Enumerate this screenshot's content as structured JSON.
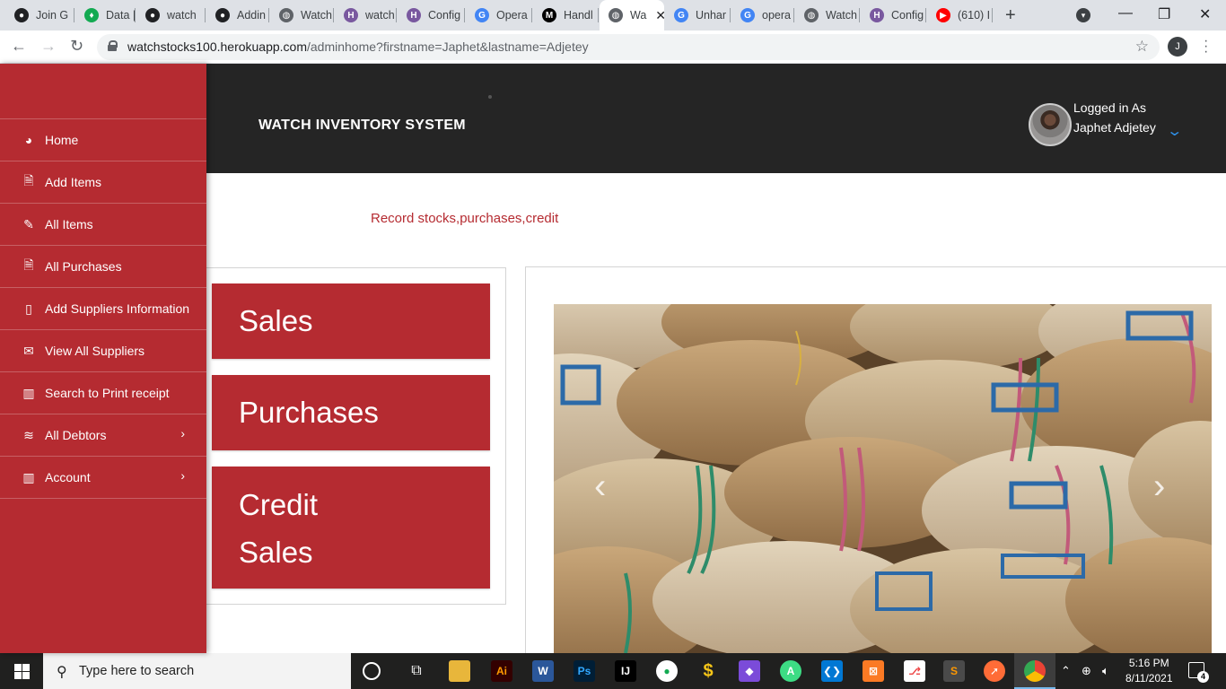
{
  "browser": {
    "tabs": [
      {
        "title": "Join G",
        "icon": "github-icon",
        "color": "#202124"
      },
      {
        "title": "Data |",
        "icon": "mongodb-icon",
        "color": "#13aa52"
      },
      {
        "title": "watch",
        "icon": "github-icon",
        "color": "#202124"
      },
      {
        "title": "Addin",
        "icon": "github-icon",
        "color": "#202124"
      },
      {
        "title": "Watch",
        "icon": "globe-icon",
        "color": "#5f6368"
      },
      {
        "title": "watch",
        "icon": "heroku-icon",
        "color": "#79589f"
      },
      {
        "title": "Config",
        "icon": "heroku-icon",
        "color": "#79589f"
      },
      {
        "title": "Opera",
        "icon": "google-icon",
        "color": "#4285f4"
      },
      {
        "title": "Handl",
        "icon": "medium-icon",
        "color": "#000000"
      },
      {
        "title": "Wa",
        "icon": "globe-icon",
        "color": "#5f6368",
        "active": true
      },
      {
        "title": "Unhar",
        "icon": "google-icon",
        "color": "#4285f4"
      },
      {
        "title": "opera",
        "icon": "google-icon",
        "color": "#4285f4"
      },
      {
        "title": "Watch",
        "icon": "globe-icon",
        "color": "#5f6368"
      },
      {
        "title": "Config",
        "icon": "heroku-icon",
        "color": "#79589f"
      },
      {
        "title": "(610) I",
        "icon": "youtube-icon",
        "color": "#ff0000"
      }
    ],
    "url_host": "watchstocks100.herokuapp.com",
    "url_path": "/adminhome?firstname=Japhet&lastname=Adjetey",
    "profile_initial": "J"
  },
  "sidebar": {
    "items": [
      {
        "label": "Home",
        "icon": "dashboard-icon"
      },
      {
        "label": "Add Items",
        "icon": "document-icon"
      },
      {
        "label": "All Items",
        "icon": "pencil-icon"
      },
      {
        "label": "All Purchases",
        "icon": "document-icon"
      },
      {
        "label": "Add Suppliers Information",
        "icon": "book-icon"
      },
      {
        "label": "View All Suppliers",
        "icon": "envelope-icon"
      },
      {
        "label": "Search to Print receipt",
        "icon": "bar-chart-icon"
      },
      {
        "label": "All Debtors",
        "icon": "layers-icon",
        "expandable": true
      },
      {
        "label": "Account",
        "icon": "bar-chart-icon",
        "expandable": true
      }
    ]
  },
  "header": {
    "brand": "WATCH INVENTORY SYSTEM",
    "login_label": "Logged in As",
    "user_name": "Japhet Adjetey"
  },
  "main": {
    "tagline": "Record stocks,purchases,credit",
    "buttons": {
      "sales": "Sales",
      "purchases": "Purchases",
      "credit_line1": "Credit",
      "credit_line2": "Sales"
    }
  },
  "taskbar": {
    "search_placeholder": "Type here to search",
    "time": "5:16 PM",
    "date": "8/11/2021",
    "notification_count": "4"
  },
  "colors": {
    "brand_red": "#b52b31",
    "header_dark": "#252525",
    "accent_blue": "#2f8fe6"
  }
}
